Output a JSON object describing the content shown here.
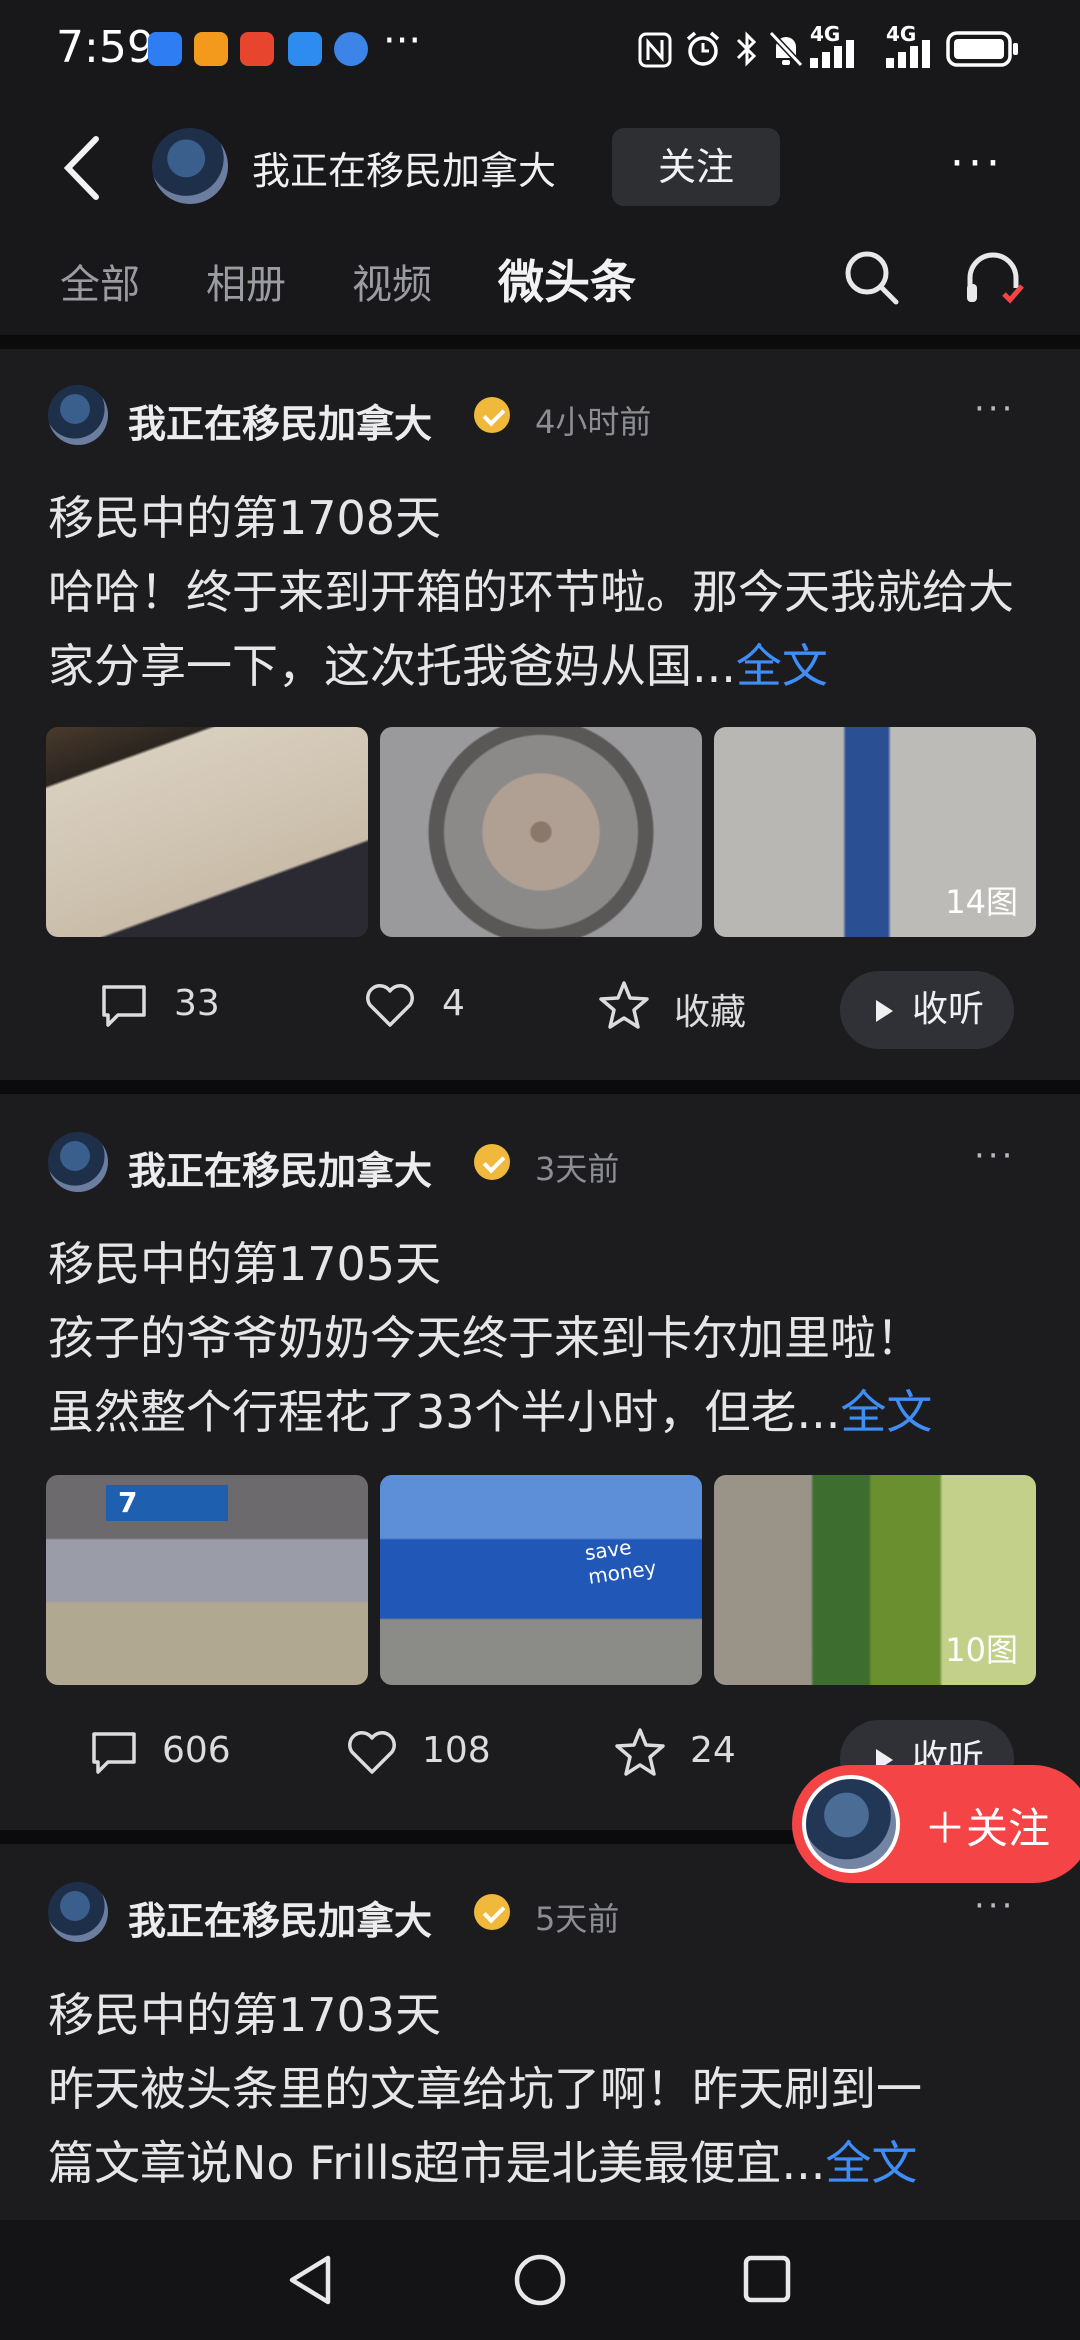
{
  "status_bar": {
    "time": "7:59",
    "more": "···",
    "network_1": "4G",
    "network_2": "4G",
    "app_icons": [
      "shield-icon",
      "notes-icon",
      "flight-icon",
      "browser-icon",
      "globe-icon"
    ],
    "right_icons": [
      "nfc-icon",
      "alarm-icon",
      "bluetooth-icon",
      "mute-icon",
      "signal-icon",
      "signal-icon",
      "battery-icon"
    ]
  },
  "header": {
    "account_name": "我正在移民加拿大",
    "follow_label": "关注",
    "more": "···",
    "tabs": [
      {
        "label": "全部",
        "active": false
      },
      {
        "label": "相册",
        "active": false
      },
      {
        "label": "视频",
        "active": false
      },
      {
        "label": "微头条",
        "active": true
      }
    ]
  },
  "posts": [
    {
      "author": "我正在移民加拿大",
      "time": "4小时前",
      "title": "移民中的第1708天",
      "body": "哈哈！终于来到开箱的环节啦。那今天我就给大家分享一下，这次托我爸妈从国...",
      "full_text": "全文",
      "image_count": "14图",
      "comments": "33",
      "likes": "4",
      "favorite": "收藏",
      "listen": "收听"
    },
    {
      "author": "我正在移民加拿大",
      "time": "3天前",
      "title": "移民中的第1705天",
      "body_line1": "孩子的爷爷奶奶今天终于来到卡尔加里啦！",
      "body_line2": "虽然整个行程花了33个半小时，但老...",
      "full_text": "全文",
      "image_count": "10图",
      "image_texts": {
        "gate_number": "7",
        "store_sign": "save money"
      },
      "comments": "606",
      "likes": "108",
      "favorite": "24",
      "listen": "收听"
    },
    {
      "author": "我正在移民加拿大",
      "time": "5天前",
      "title": "移民中的第1703天",
      "body_line1": "昨天被头条里的文章给坑了啊！昨天刷到一",
      "body_line2": "篇文章说No Frills超市是北美最便宜...",
      "full_text": "全文"
    }
  ],
  "floating_follow": {
    "label": "＋关注"
  },
  "colors": {
    "background": "#141416",
    "card": "#1c1c1f",
    "link": "#3f8ef8",
    "follow_red": "#f44446",
    "verified": "#f0b93b"
  }
}
